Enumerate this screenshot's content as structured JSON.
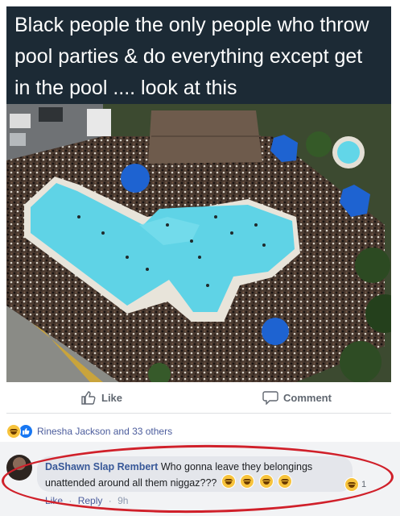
{
  "post": {
    "caption_lines": [
      "Black people the only people who throw",
      "pool parties & do everything except get",
      "in the pool .... look at this"
    ],
    "actions": {
      "like_label": "Like",
      "comment_label": "Comment"
    },
    "reactions_text": "Rinesha Jackson and 33 others"
  },
  "comment": {
    "author": "DaShawn Slap Rembert",
    "text": "Who gonna leave they belongings unattended around all them niggaz???",
    "reaction_count": "1",
    "like_label": "Like",
    "separator": "·",
    "reply_label": "Reply",
    "time": "9h"
  },
  "colors": {
    "link_blue": "#385898",
    "annotation_red": "#d0202a",
    "caption_bg": "#1c2a35",
    "pool_water": "#5fd3e6"
  }
}
